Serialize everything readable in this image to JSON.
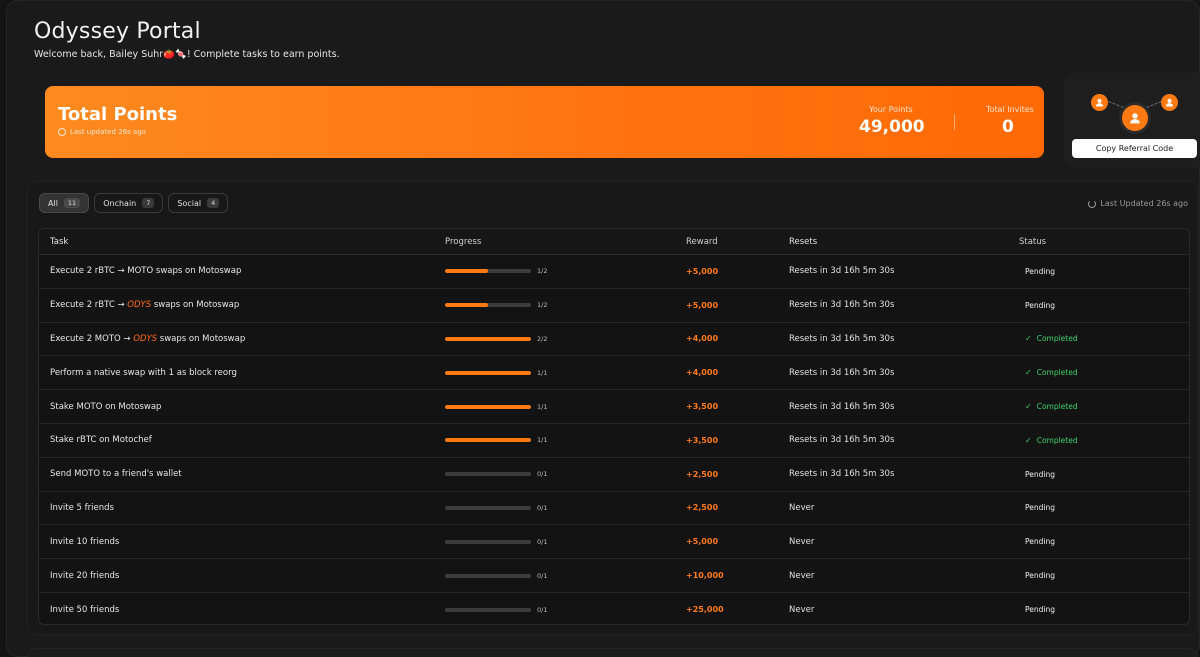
{
  "header": {
    "title": "Odyssey Portal",
    "welcome": "Welcome back, Bailey Suhr🍅🍬! Complete tasks to earn points."
  },
  "points": {
    "title": "Total Points",
    "last_updated": "Last updated 26s ago",
    "your_points_label": "Your Points",
    "your_points_value": "49,000",
    "invites_label": "Total Invites",
    "invites_value": "0"
  },
  "referral": {
    "button_label": "Copy Referral Code"
  },
  "filters": [
    {
      "label": "All",
      "count": "11",
      "active": true
    },
    {
      "label": "Onchain",
      "count": "7",
      "active": false
    },
    {
      "label": "Social",
      "count": "4",
      "active": false
    }
  ],
  "last_updated": "Last Updated 26s ago",
  "table": {
    "headers": {
      "task": "Task",
      "progress": "Progress",
      "reward": "Reward",
      "resets": "Resets",
      "status": "Status"
    },
    "rows": [
      {
        "pre": "Execute 2 rBTC → MOTO swaps on Motoswap",
        "hl": "",
        "post": "",
        "progress": "1/2",
        "fraction": 0.5,
        "reward": "+5,000",
        "resets": "Resets in 3d 16h 5m 30s",
        "status": "Pending",
        "completed": false
      },
      {
        "pre": "Execute 2 rBTC → ",
        "hl": "ODYS",
        "post": " swaps on Motoswap",
        "progress": "1/2",
        "fraction": 0.5,
        "reward": "+5,000",
        "resets": "Resets in 3d 16h 5m 30s",
        "status": "Pending",
        "completed": false
      },
      {
        "pre": "Execute 2 MOTO → ",
        "hl": "ODYS",
        "post": " swaps on Motoswap",
        "progress": "2/2",
        "fraction": 1,
        "reward": "+4,000",
        "resets": "Resets in 3d 16h 5m 30s",
        "status": "Completed",
        "completed": true
      },
      {
        "pre": "Perform a native swap with 1 as block reorg",
        "hl": "",
        "post": "",
        "progress": "1/1",
        "fraction": 1,
        "reward": "+4,000",
        "resets": "Resets in 3d 16h 5m 30s",
        "status": "Completed",
        "completed": true
      },
      {
        "pre": "Stake MOTO on Motoswap",
        "hl": "",
        "post": "",
        "progress": "1/1",
        "fraction": 1,
        "reward": "+3,500",
        "resets": "Resets in 3d 16h 5m 30s",
        "status": "Completed",
        "completed": true
      },
      {
        "pre": "Stake rBTC on Motochef",
        "hl": "",
        "post": "",
        "progress": "1/1",
        "fraction": 1,
        "reward": "+3,500",
        "resets": "Resets in 3d 16h 5m 30s",
        "status": "Completed",
        "completed": true
      },
      {
        "pre": "Send MOTO to a friend's wallet",
        "hl": "",
        "post": "",
        "progress": "0/1",
        "fraction": 0,
        "reward": "+2,500",
        "resets": "Resets in 3d 16h 5m 30s",
        "status": "Pending",
        "completed": false
      },
      {
        "pre": "Invite 5 friends",
        "hl": "",
        "post": "",
        "progress": "0/1",
        "fraction": 0,
        "reward": "+2,500",
        "resets": "Never",
        "status": "Pending",
        "completed": false
      },
      {
        "pre": "Invite 10 friends",
        "hl": "",
        "post": "",
        "progress": "0/1",
        "fraction": 0,
        "reward": "+5,000",
        "resets": "Never",
        "status": "Pending",
        "completed": false
      },
      {
        "pre": "Invite 20 friends",
        "hl": "",
        "post": "",
        "progress": "0/1",
        "fraction": 0,
        "reward": "+10,000",
        "resets": "Never",
        "status": "Pending",
        "completed": false
      },
      {
        "pre": "Invite 50 friends",
        "hl": "",
        "post": "",
        "progress": "0/1",
        "fraction": 0,
        "reward": "+25,000",
        "resets": "Never",
        "status": "Pending",
        "completed": false
      }
    ]
  },
  "colors": {
    "accent": "#ff7a12",
    "completed": "#3ecf6b"
  }
}
